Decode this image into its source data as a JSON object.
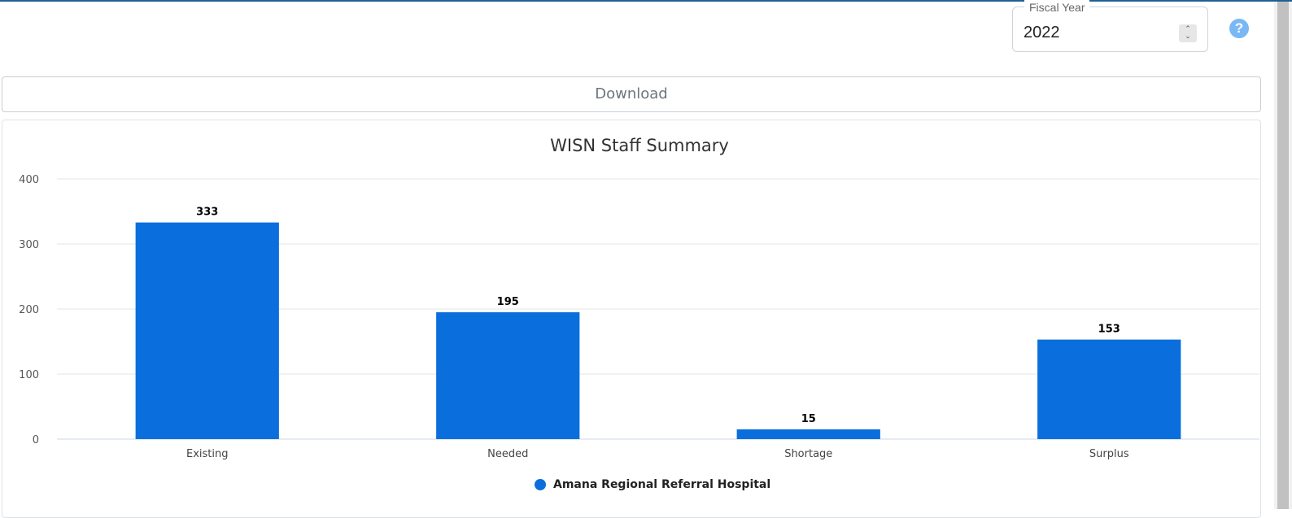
{
  "fiscal_year": {
    "legend": "Fiscal Year",
    "value": "2022",
    "spinner_up": "⌃",
    "spinner_down": "⌄"
  },
  "help": {
    "icon": "question-circle-icon",
    "glyph": "?"
  },
  "download": {
    "label": "Download"
  },
  "colors": {
    "bar": "#0a6fdc",
    "accent": "#1f5f95",
    "help": "#7ab8f5"
  },
  "chart_data": {
    "type": "bar",
    "title": "WISN Staff Summary",
    "xlabel": "",
    "ylabel": "",
    "categories": [
      "Existing",
      "Needed",
      "Shortage",
      "Surplus"
    ],
    "series": [
      {
        "name": "Amana Regional Referral Hospital",
        "values": [
          333,
          195,
          15,
          153
        ]
      }
    ],
    "ylim": [
      0,
      400
    ],
    "yticks": [
      0,
      100,
      200,
      300,
      400
    ],
    "grid": true,
    "legend_position": "bottom-center",
    "data_labels": true
  }
}
